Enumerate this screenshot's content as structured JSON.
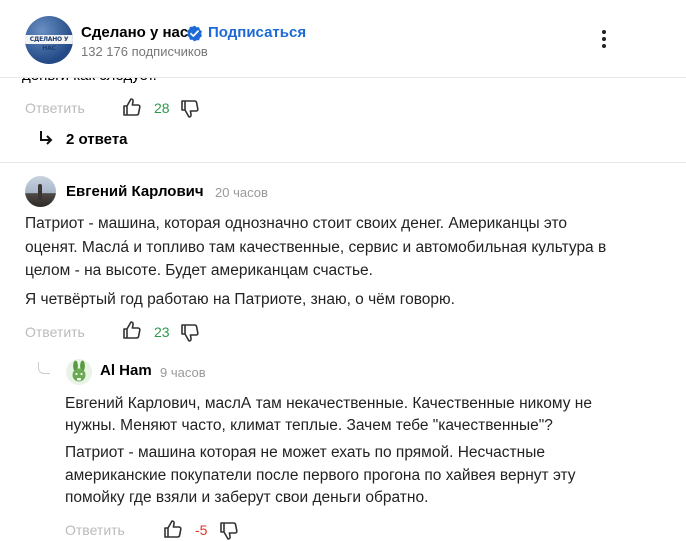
{
  "header": {
    "avatar_text": "СДЕЛАНО У НАС",
    "channel_name": "Сделано у нас",
    "subscribe_label": "Подписаться",
    "subscribers": "132 176 подписчиков"
  },
  "comment_prev": {
    "cut_text": "деньги как следует.",
    "reply_label": "Ответить",
    "likes": "28",
    "replies_toggle": "2 ответа"
  },
  "comment_main": {
    "author": "Евгений Карлович",
    "time": "20 часов",
    "paragraphs": [
      "Патриот - машина, которая однозначно стоит своих денег. Американцы это",
      "оценят. Масла́ и топливо там качественные, сервис и автомобильная культура в",
      "целом - на высоте. Будет американцам счастье.",
      "Я четвёртый год работаю на Патриоте, знаю, о чём говорю."
    ],
    "reply_label": "Ответить",
    "likes": "23"
  },
  "comment_reply": {
    "author": "Al Ham",
    "time": "9 часов",
    "lines": [
      "Евгений Карлович, маслА там некачественные. Качественные никому не",
      "нужны. Меняют часто, климат теплые. Зачем тебе \"качественные\"?",
      "Патриот - машина которая не может ехать по прямой. Несчастные",
      "американские покупатели после первого прогона по хайвея вернут эту",
      "помойку где взяли и заберут свои деньги обратно."
    ],
    "reply_label": "Ответить",
    "likes": "-5"
  },
  "icons": {
    "verified": "verified-badge-icon",
    "like": "thumb-up-icon",
    "dislike": "thumb-down-icon",
    "menu": "more-vertical-icon",
    "reply_arrow": "reply-arrow-icon"
  },
  "colors": {
    "accent": "#1d6ad6",
    "likes_positive": "#2e9a4a",
    "likes_negative": "#d83a2e",
    "muted": "#bbbbbb"
  }
}
